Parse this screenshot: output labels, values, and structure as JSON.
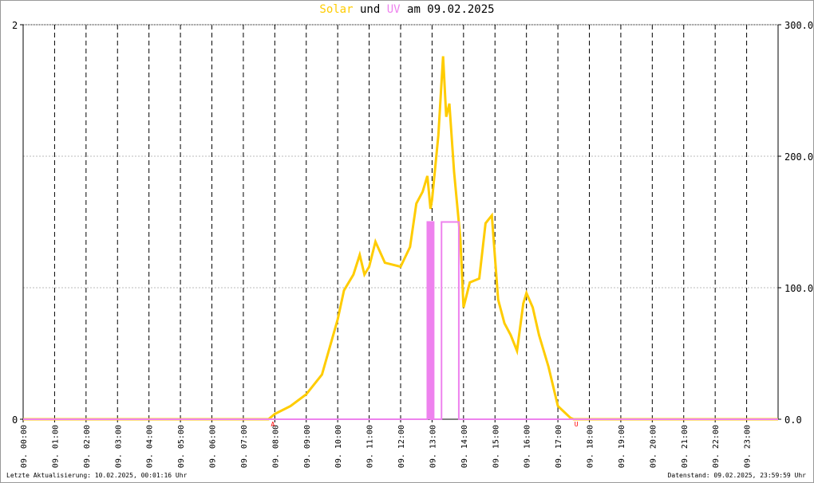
{
  "title": {
    "solar": "Solar",
    "und": "und",
    "uv": "UV",
    "rest": "am 09.02.2025"
  },
  "footer": {
    "left": "Letzte Aktualisierung: 10.02.2025, 00:01:16 Uhr",
    "right": "Datenstand: 09.02.2025, 23:59:59 Uhr"
  },
  "markers": {
    "sunrise": "A",
    "sunset": "U"
  },
  "colors": {
    "solar": "#ffcc00",
    "uv": "#ee82ee",
    "marker": "#ff0000"
  },
  "chart_data": {
    "type": "line",
    "title": "Solar und UV am 09.02.2025",
    "x_range_hours": [
      0,
      24
    ],
    "x_tick_labels": [
      "09. 00:00",
      "09. 01:00",
      "09. 02:00",
      "09. 03:00",
      "09. 04:00",
      "09. 05:00",
      "09. 06:00",
      "09. 07:00",
      "09. 08:00",
      "09. 09:00",
      "09. 10:00",
      "09. 11:00",
      "09. 12:00",
      "09. 13:00",
      "09. 14:00",
      "09. 15:00",
      "09. 16:00",
      "09. 17:00",
      "09. 18:00",
      "09. 19:00",
      "09. 20:00",
      "09. 21:00",
      "09. 22:00",
      "09. 23:00"
    ],
    "left_axis": {
      "range": [
        0,
        2
      ],
      "tick_labels": [
        "2",
        "0"
      ]
    },
    "right_axis": {
      "range": [
        0,
        300
      ],
      "tick_labels": [
        "300.0",
        "200.0",
        "100.0",
        "0.0"
      ]
    },
    "series": [
      {
        "name": "Solar",
        "axis": "right",
        "points": [
          [
            0,
            0
          ],
          [
            7.8,
            0
          ],
          [
            8.0,
            4
          ],
          [
            8.5,
            10
          ],
          [
            9.0,
            19
          ],
          [
            9.5,
            34
          ],
          [
            10.0,
            76
          ],
          [
            10.2,
            98
          ],
          [
            10.5,
            110
          ],
          [
            10.7,
            125
          ],
          [
            10.85,
            110
          ],
          [
            11.0,
            116
          ],
          [
            11.2,
            135
          ],
          [
            11.5,
            119
          ],
          [
            12.0,
            116
          ],
          [
            12.3,
            131
          ],
          [
            12.5,
            164
          ],
          [
            12.7,
            173
          ],
          [
            12.85,
            185
          ],
          [
            12.95,
            160
          ],
          [
            13.0,
            167
          ],
          [
            13.2,
            216
          ],
          [
            13.35,
            276
          ],
          [
            13.45,
            230
          ],
          [
            13.55,
            240
          ],
          [
            13.7,
            188
          ],
          [
            13.9,
            137
          ],
          [
            14.0,
            85
          ],
          [
            14.2,
            104
          ],
          [
            14.5,
            107
          ],
          [
            14.7,
            149
          ],
          [
            14.9,
            155
          ],
          [
            15.1,
            91
          ],
          [
            15.3,
            73
          ],
          [
            15.5,
            64
          ],
          [
            15.7,
            52
          ],
          [
            15.9,
            88
          ],
          [
            16.0,
            96
          ],
          [
            16.2,
            85
          ],
          [
            16.4,
            64
          ],
          [
            16.7,
            40
          ],
          [
            17.0,
            10
          ],
          [
            17.4,
            1
          ],
          [
            17.5,
            0
          ],
          [
            24,
            0
          ]
        ]
      },
      {
        "name": "UV",
        "axis": "left",
        "points": [
          [
            0,
            0
          ],
          [
            12.85,
            0
          ],
          [
            12.85,
            1.0
          ],
          [
            12.95,
            1.0
          ],
          [
            12.95,
            0
          ],
          [
            13.0,
            0
          ],
          [
            13.0,
            1.0
          ],
          [
            13.05,
            1.0
          ],
          [
            13.05,
            0
          ],
          [
            13.3,
            0
          ],
          [
            13.3,
            1.0
          ],
          [
            13.85,
            1.0
          ],
          [
            13.85,
            0
          ],
          [
            24,
            0
          ]
        ]
      }
    ]
  }
}
